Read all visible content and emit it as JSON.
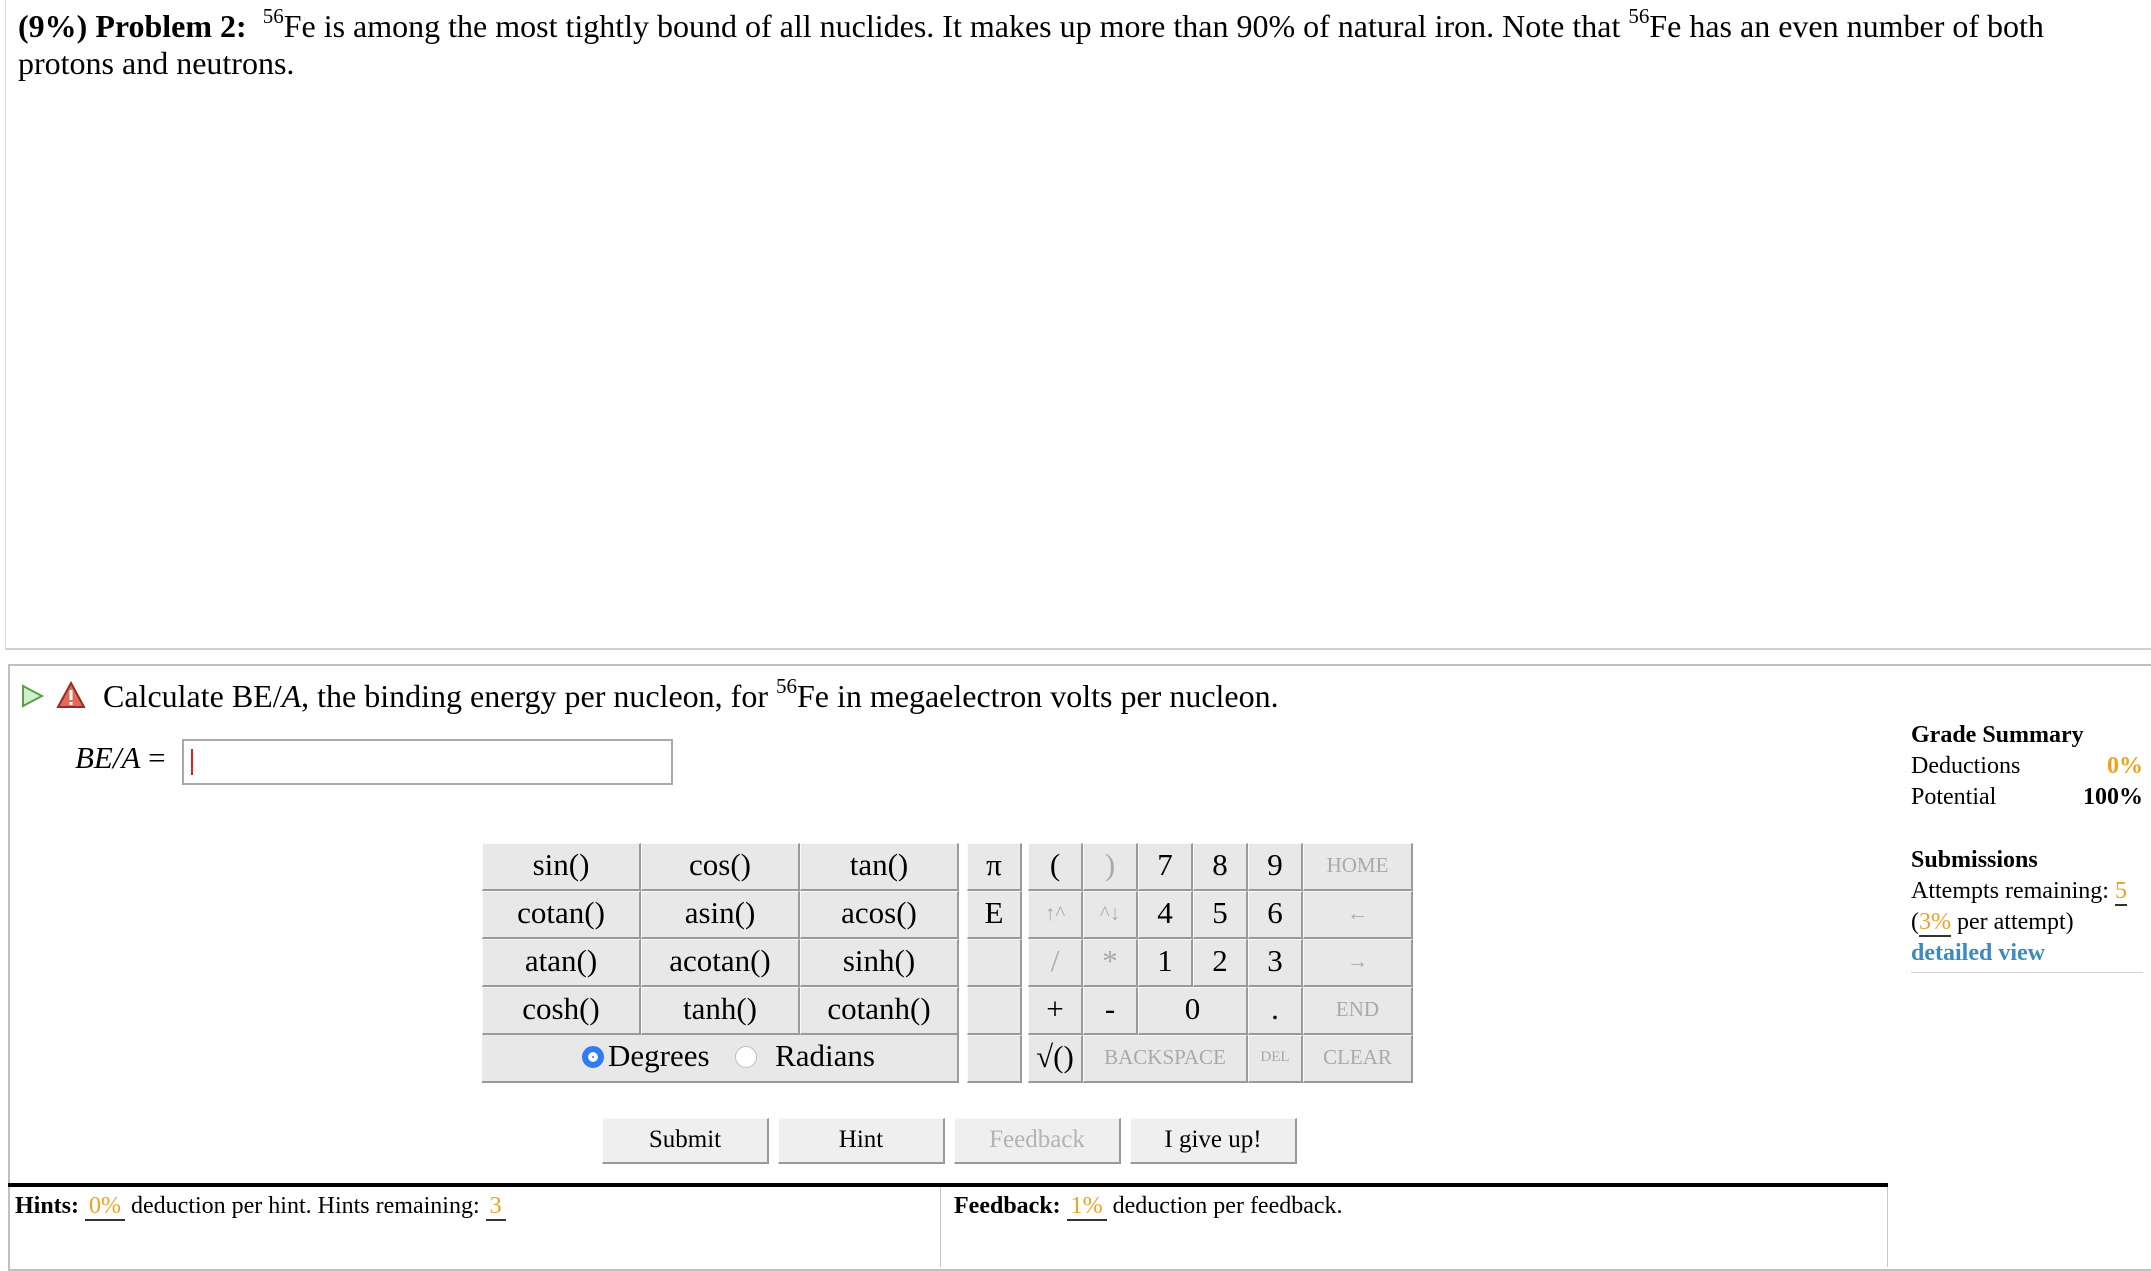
{
  "problem": {
    "percent": "(9%)",
    "label": "Problem 2:",
    "sup1": "56",
    "text1": "Fe is among the most tightly bound of all nuclides. It makes up more than 90% of natural iron. Note that ",
    "sup2": "56",
    "text2": "Fe has an even number of both protons and neutrons."
  },
  "question": {
    "text1": "Calculate BE/",
    "italic": "A",
    "text2": ", the binding energy per nucleon, for ",
    "sup": "56",
    "text3": "Fe in megaelectron volts per nucleon."
  },
  "answer": {
    "label": "BE/A",
    "equals": " = ",
    "value": ""
  },
  "keypad": {
    "functions": [
      [
        "sin()",
        "cos()",
        "tan()"
      ],
      [
        "cotan()",
        "asin()",
        "acos()"
      ],
      [
        "atan()",
        "acotan()",
        "sinh()"
      ],
      [
        "cosh()",
        "tanh()",
        "cotanh()"
      ]
    ],
    "degrees_label": "Degrees",
    "radians_label": "Radians",
    "angle_mode": "Degrees",
    "pi": "π",
    "e": "E",
    "open_paren": "(",
    "close_paren": ")",
    "up_caret": "↑^",
    "down_caret": "^↓",
    "slash": "/",
    "star": "*",
    "plus": "+",
    "minus": "-",
    "sqrt": "√()",
    "digits": [
      "7",
      "8",
      "9",
      "4",
      "5",
      "6",
      "1",
      "2",
      "3",
      "0",
      "."
    ],
    "home": "HOME",
    "left_arrow": "←",
    "right_arrow": "→",
    "end": "END",
    "backspace": "BACKSPACE",
    "del": "DEL",
    "clear": "CLEAR"
  },
  "buttons": {
    "submit": "Submit",
    "hint": "Hint",
    "feedback": "Feedback",
    "give_up": "I give up!"
  },
  "hints": {
    "label": "Hints:",
    "deduction": "0%",
    "text1": " deduction per hint. Hints remaining: ",
    "remaining": "3"
  },
  "feedback": {
    "label": "Feedback:",
    "deduction": "1%",
    "text": " deduction per feedback."
  },
  "grade_summary": {
    "title": "Grade Summary",
    "deductions_label": "Deductions",
    "deductions_value": "0%",
    "potential_label": "Potential",
    "potential_value": "100%"
  },
  "submissions": {
    "title": "Submissions",
    "attempts_label": "Attempts remaining: ",
    "attempts_value": "5",
    "per_attempt_open": "(",
    "per_attempt_pct": "3%",
    "per_attempt_text": " per attempt)",
    "detailed_view": "detailed view"
  },
  "colors": {
    "accent_orange": "#f0a020",
    "link_blue": "#3a8bbf",
    "radio_blue": "#2f7cf6"
  }
}
